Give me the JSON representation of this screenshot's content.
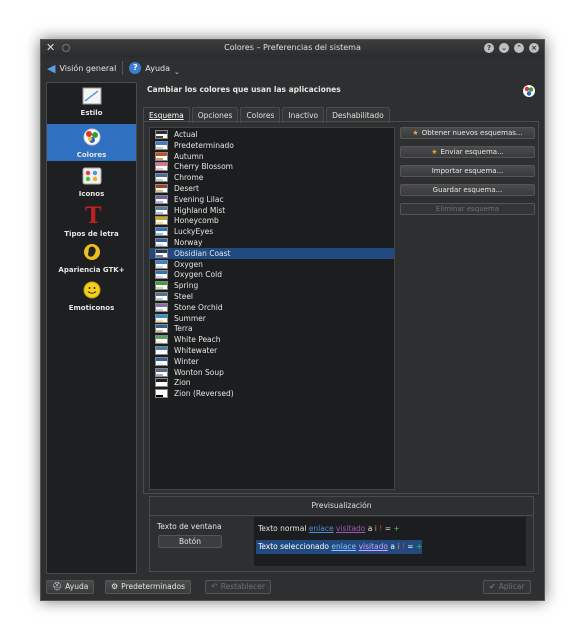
{
  "window": {
    "title": "Colores – Preferencias del sistema"
  },
  "toolbar": {
    "overview": "Visión general",
    "help": "Ayuda"
  },
  "sidebar": {
    "items": [
      {
        "label": "Estilo",
        "icon": "style-icon"
      },
      {
        "label": "Colores",
        "icon": "colors-icon",
        "active": true
      },
      {
        "label": "Iconos",
        "icon": "icons-icon"
      },
      {
        "label": "Tipos de letra",
        "icon": "fonts-icon"
      },
      {
        "label": "Apariencia GTK+",
        "icon": "gtk-icon"
      },
      {
        "label": "Emoticonos",
        "icon": "emoticons-icon"
      }
    ]
  },
  "header": {
    "title": "Cambiar los colores que usan las aplicaciones"
  },
  "tabs": [
    {
      "label": "Esquema",
      "active": true
    },
    {
      "label": "Opciones"
    },
    {
      "label": "Colores"
    },
    {
      "label": "Inactivo"
    },
    {
      "label": "Deshabilitado"
    }
  ],
  "schemes": [
    {
      "name": "Actual",
      "colors": [
        "#2e2f30",
        "#444444"
      ]
    },
    {
      "name": "Predeterminado",
      "colors": [
        "#3a7fd0",
        "#cccccc"
      ]
    },
    {
      "name": "Autumn",
      "colors": [
        "#c05020",
        "#d0a070"
      ]
    },
    {
      "name": "Cherry Blossom",
      "colors": [
        "#e07090",
        "#f0c0d0"
      ]
    },
    {
      "name": "Chrome",
      "colors": [
        "#4a6a9a",
        "#cccccc"
      ]
    },
    {
      "name": "Desert",
      "colors": [
        "#a04020",
        "#e0c090"
      ]
    },
    {
      "name": "Evening Lilac",
      "colors": [
        "#7060a0",
        "#c0b0e0"
      ]
    },
    {
      "name": "Highland Mist",
      "colors": [
        "#5a7a9a",
        "#b0c0d0"
      ]
    },
    {
      "name": "Honeycomb",
      "colors": [
        "#d0a020",
        "#f0e0a0"
      ]
    },
    {
      "name": "LuckyEyes",
      "colors": [
        "#3070c0",
        "#a0c0f0"
      ]
    },
    {
      "name": "Norway",
      "colors": [
        "#3060a0",
        "#d0d8e8"
      ]
    },
    {
      "name": "Obsidian Coast",
      "colors": [
        "#303850",
        "#6080c0"
      ],
      "selected": true
    },
    {
      "name": "Oxygen",
      "colors": [
        "#3a7fd0",
        "#d8d8d8"
      ]
    },
    {
      "name": "Oxygen Cold",
      "colors": [
        "#3a70b0",
        "#d0d8e0"
      ]
    },
    {
      "name": "Spring",
      "colors": [
        "#40a040",
        "#c0e0a0"
      ]
    },
    {
      "name": "Steel",
      "colors": [
        "#507090",
        "#c0c8d0"
      ]
    },
    {
      "name": "Stone Orchid",
      "colors": [
        "#8070a0",
        "#d0c8d8"
      ]
    },
    {
      "name": "Summer",
      "colors": [
        "#3090d0",
        "#f0e0a0"
      ]
    },
    {
      "name": "Terra",
      "colors": [
        "#306090",
        "#d0c0a0"
      ]
    },
    {
      "name": "White Peach",
      "colors": [
        "#60a060",
        "#f8e8d8"
      ]
    },
    {
      "name": "Whitewater",
      "colors": [
        "#4080c0",
        "#ffffff"
      ]
    },
    {
      "name": "Winter",
      "colors": [
        "#3060a0",
        "#e8f0f8"
      ]
    },
    {
      "name": "Wonton Soup",
      "colors": [
        "#5a6a7a",
        "#a0b0c0"
      ]
    },
    {
      "name": "Zion",
      "colors": [
        "#202020",
        "#ffffff"
      ]
    },
    {
      "name": "Zion (Reversed)",
      "colors": [
        "#ffffff",
        "#000000"
      ]
    }
  ],
  "actions": {
    "get_new": "Obtener nuevos esquemas...",
    "upload": "Enviar esquema...",
    "import": "Importar esquema...",
    "save": "Guardar esquema...",
    "remove": "Eliminar esquema"
  },
  "preview": {
    "title": "Previsualización",
    "window_text_label": "Texto de ventana",
    "button_label": "Botón",
    "normal_text": "Texto normal",
    "selected_text": "Texto seleccionado",
    "link": "enlace",
    "visited": "visitado",
    "a": "a",
    "neutral": "i",
    "negative": "!",
    "equal": "=",
    "positive": "+"
  },
  "bottom": {
    "help": "Ayuda",
    "defaults": "Predeterminados",
    "reset": "Restablecer",
    "apply": "Aplicar"
  }
}
